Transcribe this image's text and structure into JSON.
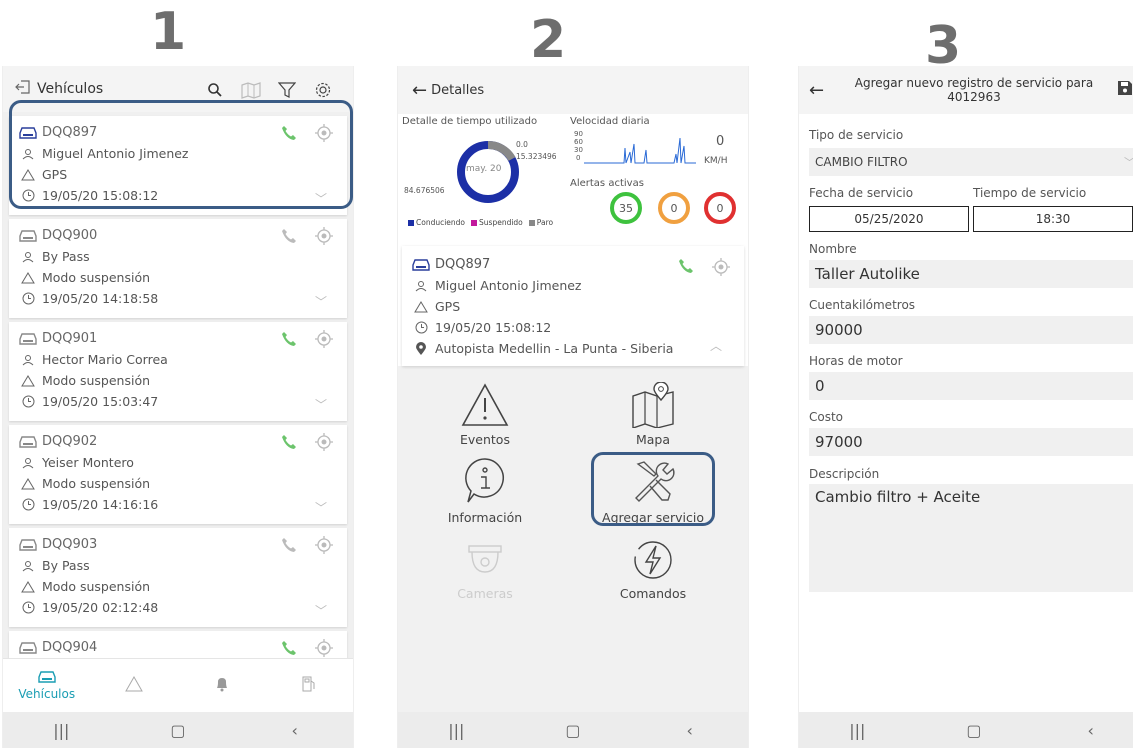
{
  "steps": [
    "1",
    "2",
    "3"
  ],
  "screen1": {
    "title": "Vehículos",
    "vehicles": [
      {
        "plate": "DQQ897",
        "driver": "Miguel Antonio Jimenez",
        "status": "GPS",
        "time": "19/05/20 15:08:12",
        "phone_active": true
      },
      {
        "plate": "DQQ900",
        "driver": "By Pass",
        "status": "Modo suspensión",
        "time": "19/05/20 14:18:58",
        "phone_active": false
      },
      {
        "plate": "DQQ901",
        "driver": "Hector Mario Correa",
        "status": "Modo suspensión",
        "time": "19/05/20 15:03:47",
        "phone_active": true
      },
      {
        "plate": "DQQ902",
        "driver": "Yeiser Montero",
        "status": "Modo suspensión",
        "time": "19/05/20 14:16:16",
        "phone_active": true
      },
      {
        "plate": "DQQ903",
        "driver": "By Pass",
        "status": "Modo suspensión",
        "time": "19/05/20 02:12:48",
        "phone_active": false
      },
      {
        "plate": "DQQ904",
        "driver": "",
        "status": "",
        "time": "",
        "phone_active": true
      }
    ],
    "tabs": {
      "vehicles_label": "Vehículos"
    }
  },
  "screen2": {
    "title": "Detalles",
    "time_detail_label": "Detalle de tiempo utilizado",
    "donut_center": "may. 20",
    "donut_value_a": "0.0",
    "donut_value_b": "15.323496",
    "donut_value_c": "84.676506",
    "speed_label": "Velocidad diaria",
    "speed_ticks": [
      "90",
      "60",
      "30",
      "0"
    ],
    "speed_value": "0",
    "speed_unit": "KM/H",
    "alerts_label": "Alertas activas",
    "alerts": [
      {
        "value": "35",
        "color": "#3ec23e"
      },
      {
        "value": "0",
        "color": "#f0a040"
      },
      {
        "value": "0",
        "color": "#e03030"
      }
    ],
    "legend": [
      "Conduciendo",
      "Suspendido",
      "Paro"
    ],
    "legend_colors": [
      "#1c2fa6",
      "#c2189c",
      "#888888"
    ],
    "vehicle": {
      "plate": "DQQ897",
      "driver": "Miguel Antonio Jimenez",
      "status": "GPS",
      "time": "19/05/20 15:08:12",
      "location": "Autopista Medellin - La Punta - Siberia"
    },
    "menu": {
      "events": "Eventos",
      "map": "Mapa",
      "info": "Información",
      "add_service": "Agregar servicio",
      "cameras": "Cameras",
      "commands": "Comandos"
    }
  },
  "screen3": {
    "title": "Agregar nuevo registro de servicio para 4012963",
    "service_type_label": "Tipo de servicio",
    "service_type_value": "CAMBIO FILTRO",
    "date_label": "Fecha de servicio",
    "date_value": "05/25/2020",
    "time_label": "Tiempo de servicio",
    "time_value": "18:30",
    "name_label": "Nombre",
    "name_value": "Taller Autolike",
    "odometer_label": "Cuentakilómetros",
    "odometer_value": "90000",
    "engine_hours_label": "Horas de motor",
    "engine_hours_value": "0",
    "cost_label": "Costo",
    "cost_value": "97000",
    "description_label": "Descripción",
    "description_value": "Cambio filtro + Aceite"
  },
  "colors": {
    "accent": "#1a9db3",
    "highlight": "#3b5c86",
    "phone_green": "#6cc46c",
    "car_blue": "#2a3f9c"
  }
}
